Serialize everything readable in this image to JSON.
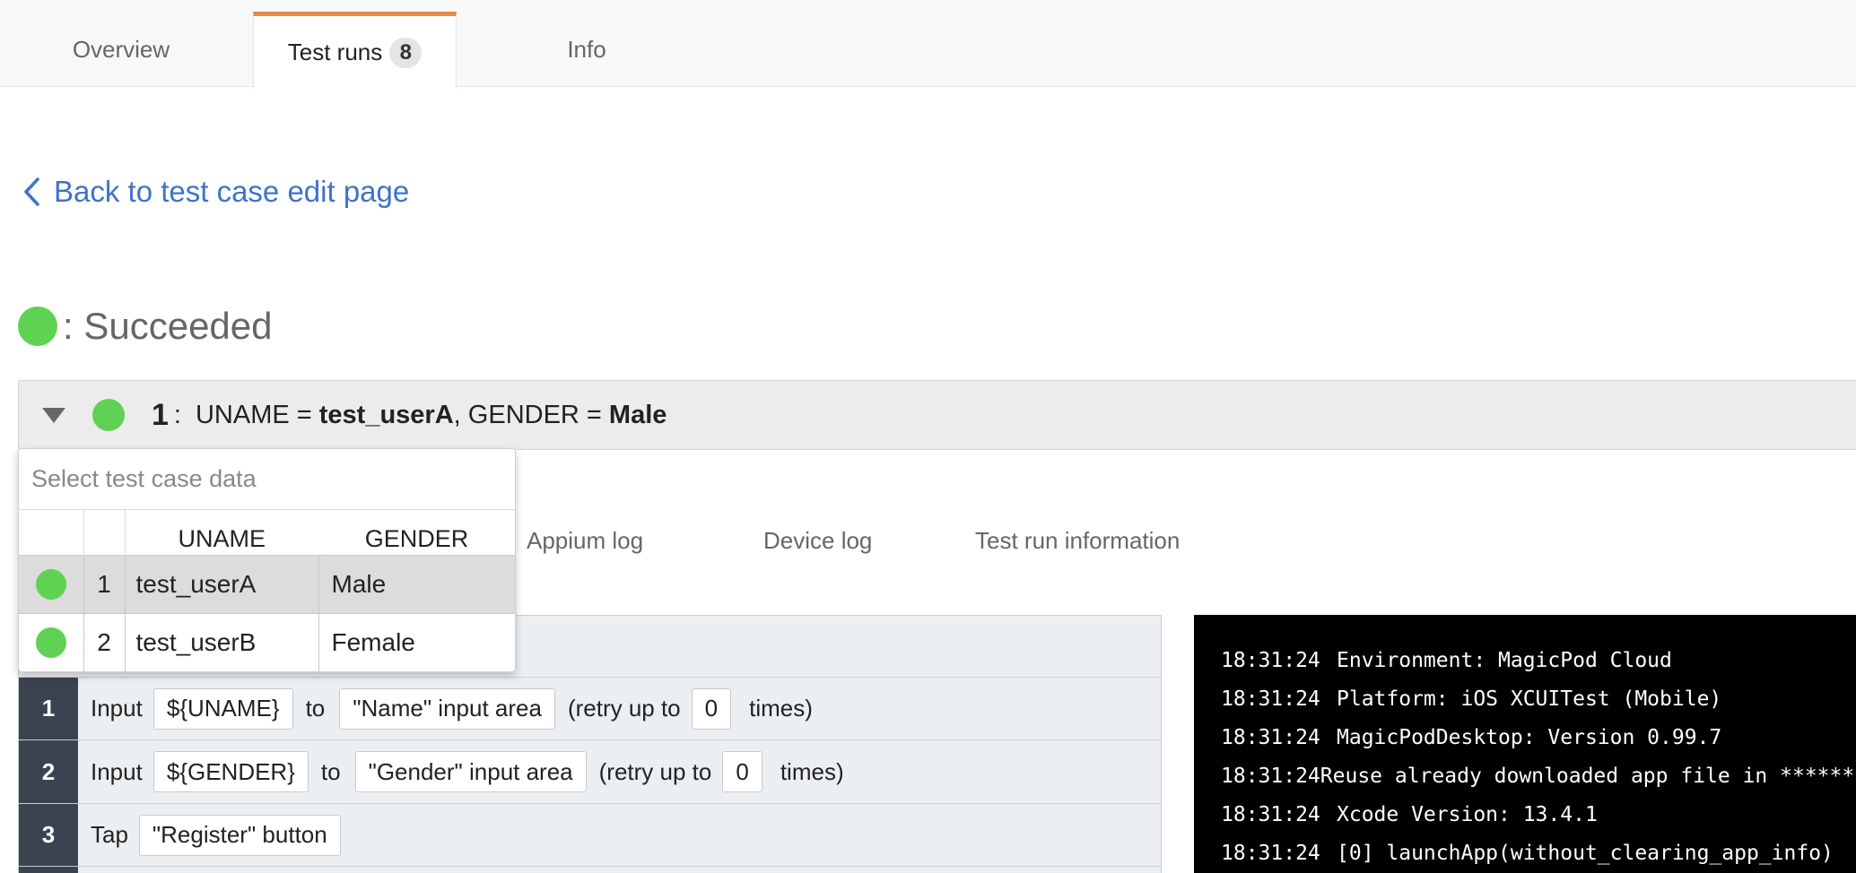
{
  "tabs": {
    "overview": "Overview",
    "test_runs": "Test runs",
    "test_runs_count": "8",
    "info": "Info"
  },
  "back_link": "Back to test case edit page",
  "status": {
    "label": ": Succeeded",
    "color": "#5fd254"
  },
  "run_header": {
    "number": "1",
    "colon": ":",
    "uname_key": "UNAME = ",
    "uname_value": "test_userA",
    "sep": ", ",
    "gender_key": "GENDER = ",
    "gender_value": "Male"
  },
  "dropdown": {
    "placeholder": "Select test case data",
    "headers": [
      "",
      "",
      "UNAME",
      "GENDER"
    ],
    "rows": [
      {
        "num": "1",
        "uname": "test_userA",
        "gender": "Male",
        "selected": true
      },
      {
        "num": "2",
        "uname": "test_userB",
        "gender": "Female",
        "selected": false
      }
    ]
  },
  "subtabs": {
    "appium_log": "Appium log",
    "device_log": "Device log",
    "test_run_info": "Test run information"
  },
  "steps": [
    {
      "num": "1",
      "verb": "Input",
      "value": "${UNAME}",
      "to": "to",
      "target": "\"Name\" input area",
      "retry_pre": "(retry up to",
      "retry_count": "0",
      "retry_post": "times)"
    },
    {
      "num": "2",
      "verb": "Input",
      "value": "${GENDER}",
      "to": "to",
      "target": "\"Gender\" input area",
      "retry_pre": "(retry up to",
      "retry_count": "0",
      "retry_post": "times)"
    },
    {
      "num": "3",
      "verb": "Tap",
      "target": "\"Register\" button"
    }
  ],
  "log": [
    {
      "ts": "18:31:24",
      "msg": "Environment: MagicPod Cloud"
    },
    {
      "ts": "18:31:24",
      "msg": "Platform: iOS XCUITest (Mobile)"
    },
    {
      "ts": "18:31:24",
      "msg": "MagicPodDesktop: Version 0.99.7"
    },
    {
      "ts": "18:31:24",
      "msg": "Reuse already downloaded app file in *********"
    },
    {
      "ts": "18:31:24",
      "msg": "Xcode Version: 13.4.1"
    },
    {
      "ts": "18:31:24",
      "msg": "[0] launchApp(without_clearing_app_info)"
    }
  ]
}
